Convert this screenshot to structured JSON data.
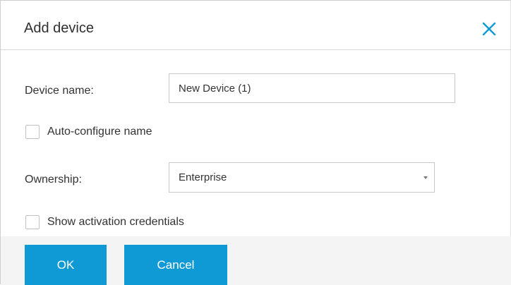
{
  "dialog": {
    "title": "Add device",
    "close_icon": "close-icon",
    "accent_color": "#0f9ad6"
  },
  "form": {
    "device_name_label": "Device name:",
    "device_name_value": "New Device (1)",
    "auto_configure_label": "Auto-configure name",
    "auto_configure_checked": false,
    "ownership_label": "Ownership:",
    "ownership_value": "Enterprise",
    "show_credentials_label": "Show activation credentials",
    "show_credentials_checked": false
  },
  "footer": {
    "ok_label": "OK",
    "cancel_label": "Cancel"
  }
}
